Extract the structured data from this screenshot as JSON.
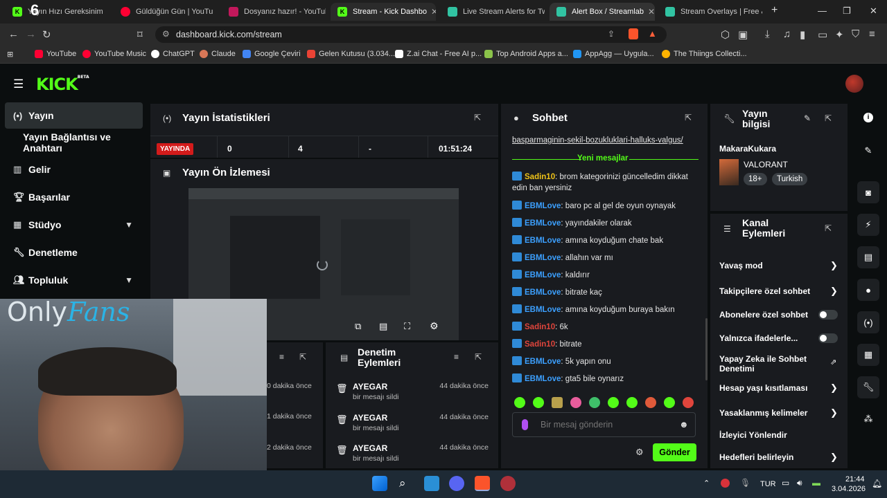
{
  "browser": {
    "tabs": [
      {
        "label": "Yayın Hızı Gereksinim",
        "favicon_color": "#53fc18"
      },
      {
        "label": "Güldüğün Gün | YouTu",
        "favicon_color": "#ff0033"
      },
      {
        "label": "Dosyanız hazır! - YouTube",
        "favicon_color": "#c2185b"
      },
      {
        "label": "Stream - Kick Dashbo",
        "favicon_color": "#53fc18"
      },
      {
        "label": "Live Stream Alerts for Twit",
        "favicon_color": "#31c3a2"
      },
      {
        "label": "Alert Box / Streamlab",
        "favicon_color": "#31c3a2"
      },
      {
        "label": "Stream Overlays | Free & P",
        "favicon_color": "#31c3a2"
      }
    ],
    "overlay_text": "6",
    "url": "dashboard.kick.com/stream",
    "bookmarks": [
      {
        "label": "YouTube",
        "color": "#ff0033"
      },
      {
        "label": "YouTube Music",
        "color": "#ff0033"
      },
      {
        "label": "ChatGPT",
        "color": "#ffffff"
      },
      {
        "label": "Claude",
        "color": "#d97757"
      },
      {
        "label": "Google Çeviri",
        "color": "#4285f4"
      },
      {
        "label": "Gelen Kutusu (3.034...",
        "color": "#ea4335"
      },
      {
        "label": "Z.ai Chat - Free AI p...",
        "color": "#ffffff"
      },
      {
        "label": "Top Android Apps a...",
        "color": "#8bc34a"
      },
      {
        "label": "AppAgg — Uygula...",
        "color": "#2196f3"
      },
      {
        "label": "The Thiings Collecti...",
        "color": "#ffb300"
      }
    ]
  },
  "kick": {
    "logo": "KICK",
    "logo_badge": "BETA",
    "sidebar": [
      {
        "label": "Yayın",
        "icon": "broadcast-icon",
        "active": true
      },
      {
        "label": "Yayın Bağlantısı ve Anahtarı",
        "icon": "",
        "active": false
      },
      {
        "label": "Gelir",
        "icon": "bar-chart-icon",
        "active": false
      },
      {
        "label": "Başarılar",
        "icon": "trophy-icon",
        "active": false
      },
      {
        "label": "Stüdyo",
        "icon": "studio-icon",
        "active": false
      },
      {
        "label": "Denetleme",
        "icon": "wrench-icon",
        "active": false
      },
      {
        "label": "Topluluk",
        "icon": "people-icon",
        "active": false
      }
    ],
    "stats": {
      "title": "Yayın İstatistikleri",
      "live_badge": "YAYINDA",
      "values": [
        "0",
        "4",
        "-",
        "01:51:24"
      ]
    },
    "preview": {
      "title": "Yayın Ön İzlemesi"
    },
    "mod_actions": {
      "title": "Denetim Eylemleri",
      "rows": [
        {
          "user": "AYEGAR",
          "action": "bir mesajı sildi",
          "time": "44 dakika önce"
        },
        {
          "user": "AYEGAR",
          "action": "bir mesajı sildi",
          "time": "44 dakika önce"
        },
        {
          "user": "AYEGAR",
          "action": "bir mesajı sildi",
          "time": "44 dakika önce"
        }
      ],
      "left_times": [
        "0 dakika önce",
        "1 dakika önce",
        "2 dakika önce"
      ]
    },
    "chat": {
      "title": "Sohbet",
      "link": "basparmaginin-sekil-bozukluklari-halluks-valgus/",
      "divider": "Yeni mesajlar",
      "messages": [
        {
          "user": "Sadin10",
          "color": "#f0c419",
          "text": ": brom kategorinizi güncelledim dikkat edin ban yersiniz"
        },
        {
          "user": "EBMLove",
          "color": "#3ca0ff",
          "text": ": baro pc al gel de oyun oynayak"
        },
        {
          "user": "EBMLove",
          "color": "#3ca0ff",
          "text": ": yayındakiler olarak"
        },
        {
          "user": "EBMLove",
          "color": "#3ca0ff",
          "text": ": amına koyduğum chate bak"
        },
        {
          "user": "EBMLove",
          "color": "#3ca0ff",
          "text": ": allahın var mı"
        },
        {
          "user": "EBMLove",
          "color": "#3ca0ff",
          "text": ": kaldırır"
        },
        {
          "user": "EBMLove",
          "color": "#3ca0ff",
          "text": ": bitrate kaç"
        },
        {
          "user": "EBMLove",
          "color": "#3ca0ff",
          "text": ": amına koyduğum buraya bakın"
        },
        {
          "user": "Sadin10",
          "color": "#e0453c",
          "text": ": 6k"
        },
        {
          "user": "Sadin10",
          "color": "#e0453c",
          "text": ": bitrate"
        },
        {
          "user": "EBMLove",
          "color": "#3ca0ff",
          "text": ": 5k yapın onu"
        },
        {
          "user": "EBMLove",
          "color": "#3ca0ff",
          "text": ": gta5 bile oynarız"
        }
      ],
      "placeholder": "Bir mesaj gönderin",
      "send": "Gönder"
    },
    "stream_info": {
      "title": "Yayın bilgisi",
      "channel": "MakaraKukara",
      "game": "VALORANT",
      "tags": [
        "18+",
        "Turkish"
      ]
    },
    "channel_actions": {
      "title": "Kanal Eylemleri",
      "rows": [
        {
          "label": "Yavaş mod",
          "control": "chevron"
        },
        {
          "label": "Takipçilere özel sohbet",
          "control": "chevron"
        },
        {
          "label": "Abonelere özel sohbet",
          "control": "toggle"
        },
        {
          "label": "Yalnızca ifadelerle...",
          "control": "toggle"
        },
        {
          "label": "Yapay Zeka ile Sohbet Denetimi",
          "control": "external"
        },
        {
          "label": "Hesap yaşı kısıtlaması",
          "control": "chevron"
        },
        {
          "label": "Yasaklanmış kelimeler",
          "control": "chevron"
        },
        {
          "label": "İzleyici Yönlendir",
          "control": "none"
        },
        {
          "label": "Hedefleri belirleyin",
          "control": "chevron"
        }
      ]
    }
  },
  "overlay": {
    "brand_a": "Only",
    "brand_b": "Fans"
  },
  "taskbar": {
    "lang": "TUR",
    "time": "21:44",
    "date": "3.04.2026"
  }
}
